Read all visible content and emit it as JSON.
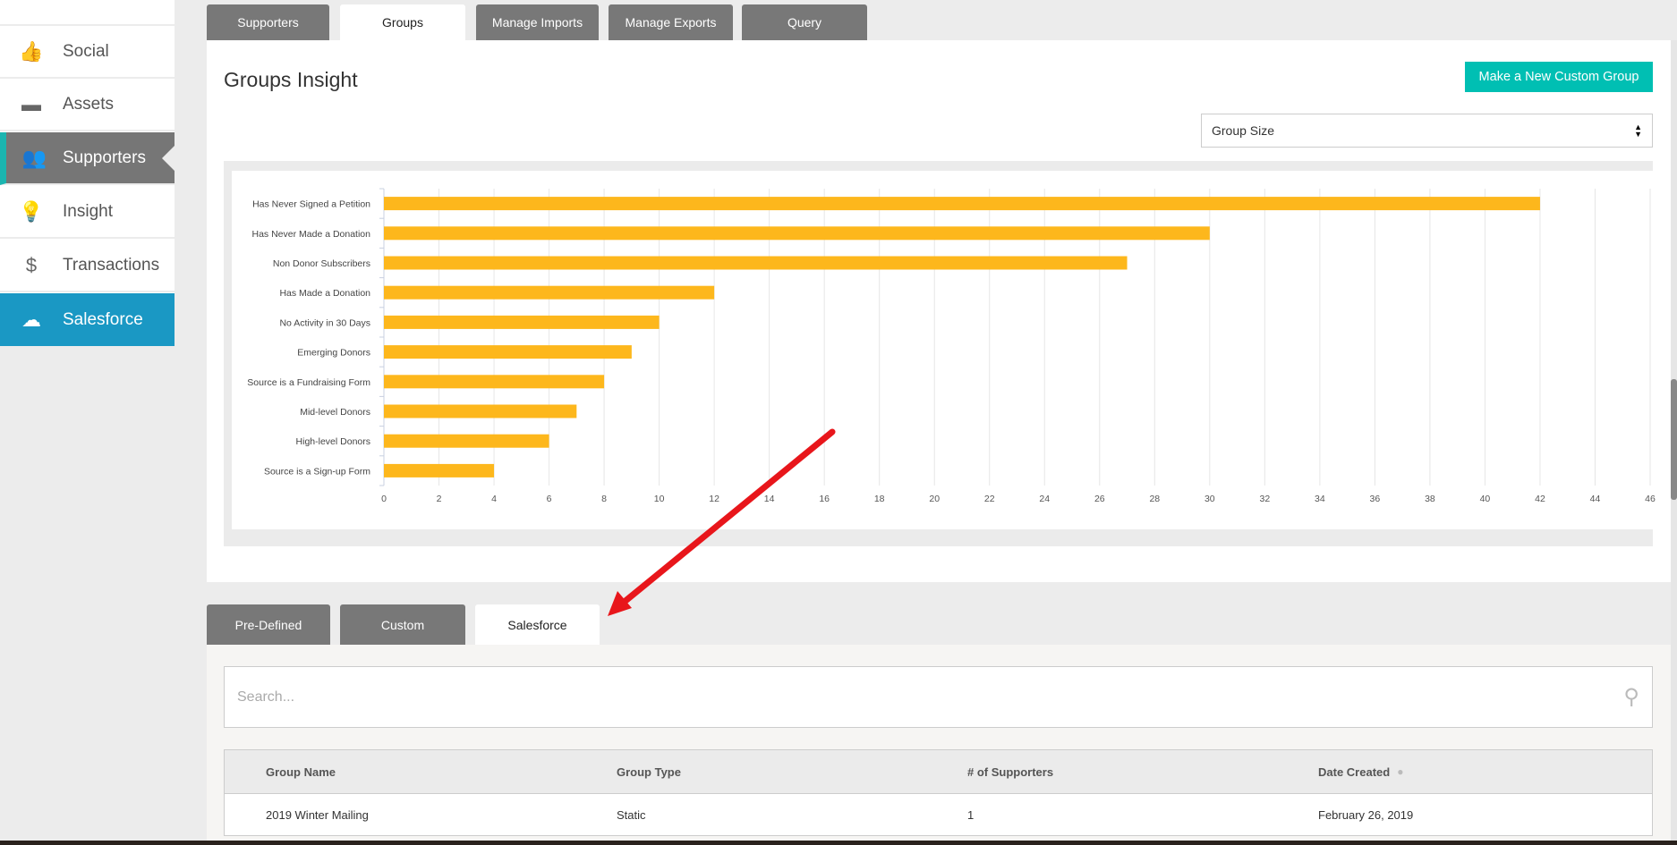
{
  "sidebar": {
    "items": [
      {
        "label": "Social",
        "icon": "thumbs-up-icon"
      },
      {
        "label": "Assets",
        "icon": "folder-icon"
      },
      {
        "label": "Supporters",
        "icon": "users-icon",
        "active": true
      },
      {
        "label": "Insight",
        "icon": "lightbulb-icon"
      },
      {
        "label": "Transactions",
        "icon": "dollar-icon"
      },
      {
        "label": "Salesforce",
        "icon": "salesforce-cloud-icon"
      }
    ]
  },
  "tabs": [
    "Supporters",
    "Groups",
    "Manage Imports",
    "Manage Exports",
    "Query"
  ],
  "active_tab": "Groups",
  "title": "Groups Insight",
  "new_group_button": "Make a New Custom Group",
  "select": {
    "value": "Group Size"
  },
  "chart_data": {
    "type": "bar",
    "orientation": "horizontal",
    "categories": [
      "Has Never Signed a Petition",
      "Has Never Made a Donation",
      "Non Donor Subscribers",
      "Has Made a Donation",
      "No Activity in 30 Days",
      "Emerging Donors",
      "Source is a Fundraising Form",
      "Mid-level Donors",
      "High-level Donors",
      "Source is a Sign-up Form"
    ],
    "values": [
      42,
      30,
      27,
      12,
      10,
      9,
      8,
      7,
      6,
      4
    ],
    "xlim": [
      0,
      46
    ],
    "xticks": [
      0,
      2,
      4,
      6,
      8,
      10,
      12,
      14,
      16,
      18,
      20,
      22,
      24,
      26,
      28,
      30,
      32,
      34,
      36,
      38,
      40,
      42,
      44,
      46
    ],
    "grid": true,
    "color": "#fdb71c"
  },
  "subtabs": [
    "Pre-Defined",
    "Custom",
    "Salesforce"
  ],
  "active_subtab": "Salesforce",
  "search": {
    "placeholder": "Search..."
  },
  "table": {
    "columns": [
      "Group Name",
      "Group Type",
      "# of Supporters",
      "Date Created"
    ],
    "rows": [
      [
        "2019 Winter Mailing",
        "Static",
        "1",
        "February 26, 2019"
      ]
    ]
  },
  "colors": {
    "accent": "#00bfb3",
    "salesforce": "#1a98c4",
    "bar": "#fdb71c",
    "annotation_arrow": "#e8161b"
  }
}
